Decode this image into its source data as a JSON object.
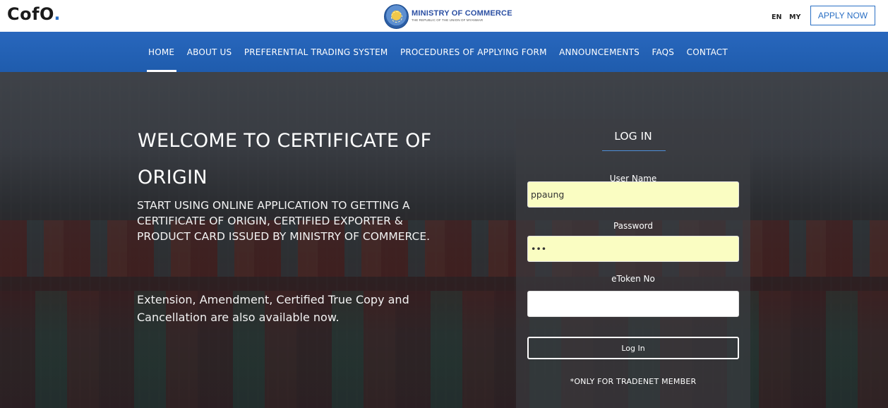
{
  "header": {
    "brand_main": "CofO",
    "brand_dot": ".",
    "ministry_title": "MINISTRY OF COMMERCE",
    "ministry_subtitle": "THE REPUBLIC OF THE UNION OF MYANMAR",
    "seal_icon": "ministry-seal-logo",
    "lang_en": "EN",
    "lang_my": "MY",
    "apply_label": "APPLY NOW",
    "accent_color": "#2a6fc4"
  },
  "nav": {
    "background_color": "#2867bd",
    "items": [
      {
        "label": "HOME",
        "active": true
      },
      {
        "label": "ABOUT US",
        "active": false
      },
      {
        "label": "PREFERENTIAL TRADING SYSTEM",
        "active": false
      },
      {
        "label": "PROCEDURES OF APPLYING FORM",
        "active": false
      },
      {
        "label": "ANNOUNCEMENTS",
        "active": false
      },
      {
        "label": "FAQS",
        "active": false
      },
      {
        "label": "CONTACT",
        "active": false
      }
    ]
  },
  "hero": {
    "title": "WELCOME TO CERTIFICATE OF ORIGIN",
    "description": "START USING ONLINE APPLICATION TO GETTING A CERTIFICATE OF ORIGIN, CERTIFIED EXPORTER & PRODUCT CARD ISSUED BY MINISTRY OF COMMERCE.",
    "note": "Extension, Amendment, Certified True Copy and Cancellation are also available now."
  },
  "login": {
    "title": "LOG IN",
    "username_label": "User Name",
    "username_value": "ppaung",
    "password_label": "Password",
    "password_value": "•••",
    "etoken_label": "eToken No",
    "etoken_value": "",
    "button_label": "Log In",
    "footnote": "*ONLY FOR TRADENET MEMBER",
    "autofill_color": "#fafdc2"
  }
}
